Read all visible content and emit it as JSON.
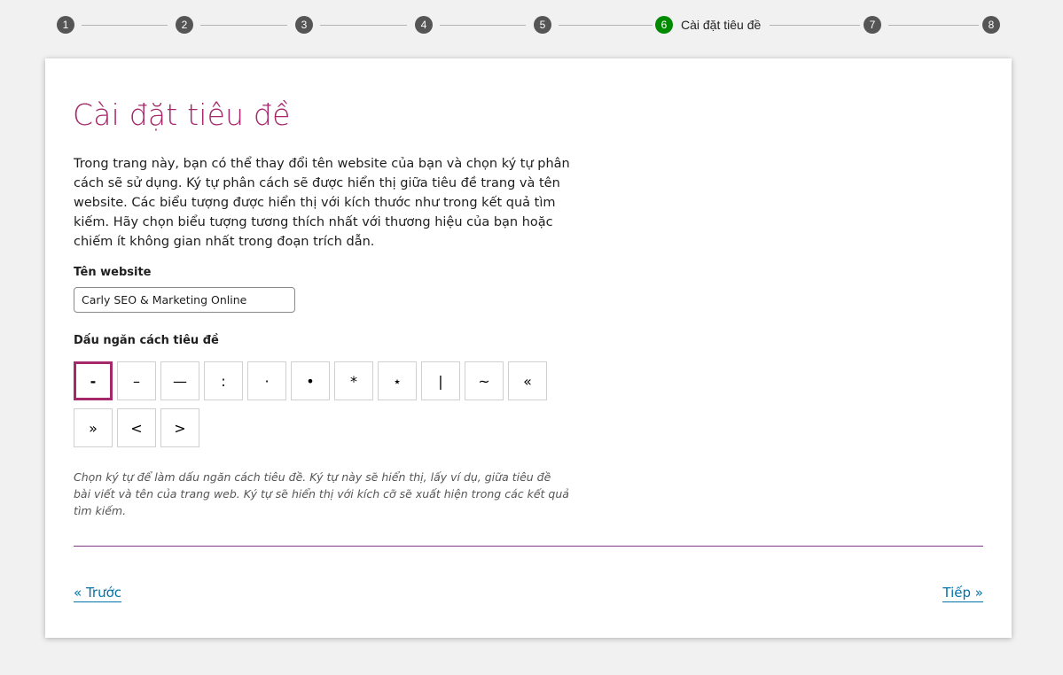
{
  "stepper": {
    "steps": [
      {
        "number": "1",
        "label": ""
      },
      {
        "number": "2",
        "label": ""
      },
      {
        "number": "3",
        "label": ""
      },
      {
        "number": "4",
        "label": ""
      },
      {
        "number": "5",
        "label": ""
      },
      {
        "number": "6",
        "label": "Cài đặt tiêu đề"
      },
      {
        "number": "7",
        "label": ""
      },
      {
        "number": "8",
        "label": ""
      }
    ],
    "active_step": "6",
    "active_color": "#008a00",
    "inactive_color": "#555555"
  },
  "main": {
    "title": "Cài đặt tiêu đề",
    "intro": "Trong trang này, bạn có thể thay đổi tên website của bạn và chọn ký tự phân cách sẽ sử dụng. Ký tự phân cách sẽ được hiển thị giữa tiêu đề trang và tên website. Các biểu tượng được hiển thị với kích thước như trong kết quả tìm kiếm. Hãy chọn biểu tượng tương thích nhất với thương hiệu của bạn hoặc chiếm ít không gian nhất trong đoạn trích dẫn.",
    "site_name_label": "Tên website",
    "site_name_value": "Carly SEO & Marketing Online",
    "separator_label": "Dấu ngăn cách tiêu đề",
    "separators": [
      "-",
      "–",
      "—",
      ":",
      "·",
      "•",
      "*",
      "⋆",
      "|",
      "~",
      "«",
      "»",
      "<",
      ">"
    ],
    "selected_separator": "-",
    "help_text": "Chọn ký tự để làm dấu ngăn cách tiêu đề. Ký tự này sẽ hiển thị, lấy ví dụ, giữa tiêu đề bài viết và tên của trang web. Ký tự sẽ hiển thị với kích cỡ sẽ xuất hiện trong các kết quả tìm kiếm.",
    "accent_color": "#a4286a"
  },
  "footer": {
    "prev_label": "« Trước",
    "next_label": "Tiếp »",
    "link_color": "#0073aa"
  }
}
